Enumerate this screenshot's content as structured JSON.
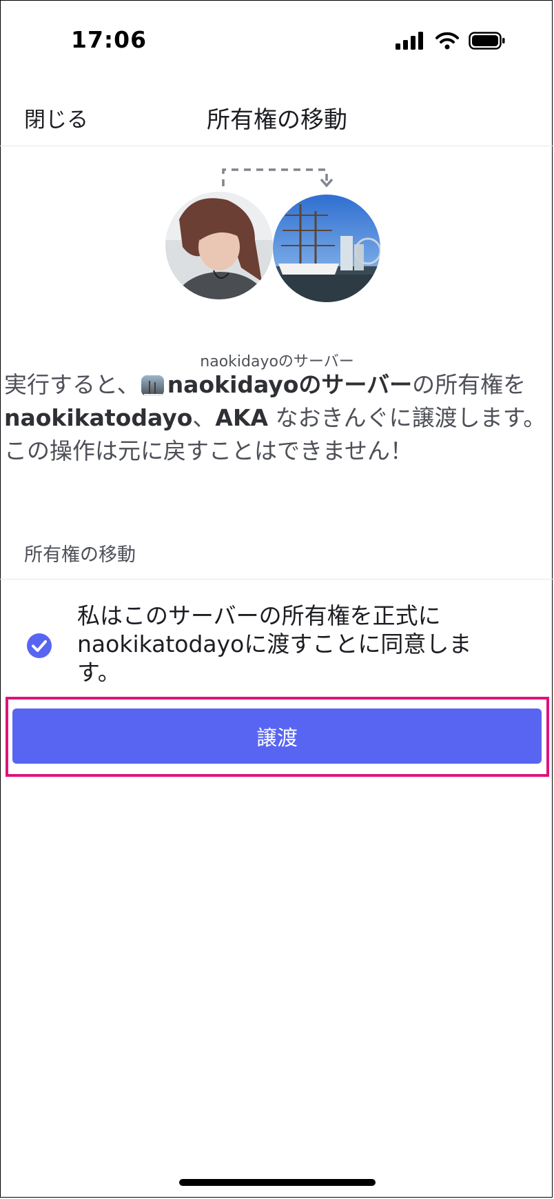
{
  "status": {
    "time": "17:06"
  },
  "nav": {
    "close_label": "閉じる",
    "title": "所有権の移動"
  },
  "transfer": {
    "server_name": "naokidayoのサーバー"
  },
  "description": {
    "prefix": "実行すると、",
    "server": "naokidayoのサーバー",
    "middle": "の所有権を",
    "recipient": "naokikatodayo",
    "sep": "、",
    "aka": "AKA",
    "alias": " なおきんぐ",
    "suffix": "に譲渡します。",
    "warning": "この操作は元に戻すことはできません！"
  },
  "section": {
    "header": "所有権の移動"
  },
  "consent": {
    "line1": "私はこのサーバーの所有権を正式に",
    "line2": "naokikatodayoに渡すことに同意しま",
    "line3": "す。",
    "checked": true
  },
  "button": {
    "label": "譲渡"
  },
  "colors": {
    "accent": "#5865f2",
    "highlight": "#e0127c"
  }
}
